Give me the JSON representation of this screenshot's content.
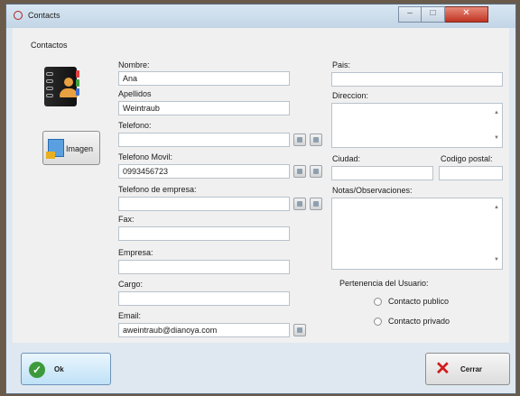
{
  "window": {
    "title": "Contacts"
  },
  "form": {
    "heading": "Contactos",
    "image_button": "Imagen",
    "labels": {
      "nombre": "Nombre:",
      "apellidos": "Apellidos",
      "telefono": "Telefono:",
      "telefono_movil": "Telefono Movil:",
      "telefono_empresa": "Telefono de empresa:",
      "fax": "Fax:",
      "empresa": "Empresa:",
      "cargo": "Cargo:",
      "email": "Email:",
      "pais": "Pais:",
      "direccion": "Direccion:",
      "ciudad": "Ciudad:",
      "codigo_postal": "Codigo postal:",
      "notas": "Notas/Observaciones:",
      "pertenencia": "Pertenencia del Usuario:"
    },
    "values": {
      "nombre": "Ana",
      "apellidos": "Weintraub",
      "telefono": "",
      "telefono_movil": "0993456723",
      "telefono_empresa": "",
      "fax": "",
      "empresa": "",
      "cargo": "",
      "email": "aweintraub@dianoya.com",
      "pais": "",
      "ciudad": "",
      "codigo_postal": ""
    },
    "radios": {
      "publico": "Contacto publico",
      "privado": "Contacto privado"
    }
  },
  "buttons": {
    "ok": "Ok",
    "cerrar": "Cerrar"
  },
  "icons": {
    "app": "circle-icon",
    "avatar": "address-book-icon",
    "image": "image-icon",
    "ok": "checkmark-icon",
    "close": "x-icon",
    "side": "square-button-icon"
  }
}
